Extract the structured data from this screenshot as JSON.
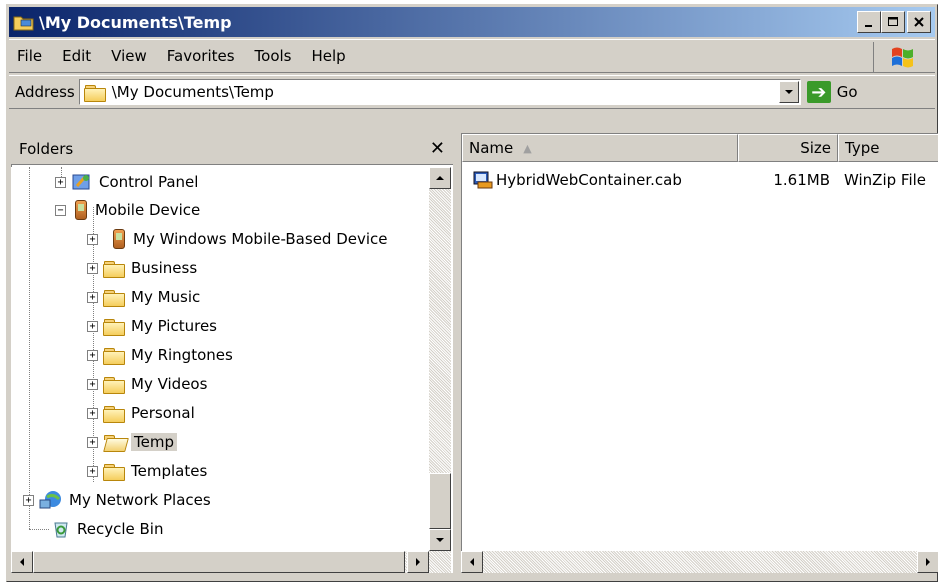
{
  "window": {
    "title": "\\My Documents\\Temp"
  },
  "menu": [
    "File",
    "Edit",
    "View",
    "Favorites",
    "Tools",
    "Help"
  ],
  "address": {
    "label": "Address",
    "value": "\\My Documents\\Temp",
    "go_label": "Go"
  },
  "folders_pane": {
    "header": "Folders",
    "close": "✕",
    "items": [
      {
        "label": "Control Panel",
        "icon": "control-panel-icon"
      },
      {
        "label": "Mobile Device",
        "icon": "mobile-device-icon"
      },
      {
        "label": "My Windows Mobile-Based Device",
        "icon": "mobile-device-icon"
      },
      {
        "label": "Business",
        "icon": "folder-icon"
      },
      {
        "label": "My Music",
        "icon": "folder-icon"
      },
      {
        "label": "My Pictures",
        "icon": "folder-icon"
      },
      {
        "label": "My Ringtones",
        "icon": "folder-icon"
      },
      {
        "label": "My Videos",
        "icon": "folder-icon"
      },
      {
        "label": "Personal",
        "icon": "folder-icon"
      },
      {
        "label": "Temp",
        "icon": "open-folder-icon",
        "selected": true
      },
      {
        "label": "Templates",
        "icon": "folder-icon"
      },
      {
        "label": "My Network Places",
        "icon": "network-places-icon"
      },
      {
        "label": "Recycle Bin",
        "icon": "recycle-bin-icon"
      }
    ]
  },
  "file_list": {
    "columns": [
      "Name",
      "Size",
      "Type"
    ],
    "rows": [
      {
        "name": "HybridWebContainer.cab",
        "size": "1.61MB",
        "type": "WinZip File"
      }
    ]
  },
  "colors": {
    "titlebar_start": "#0a246a",
    "titlebar_end": "#a6caf0",
    "chrome": "#d4d0c8"
  }
}
